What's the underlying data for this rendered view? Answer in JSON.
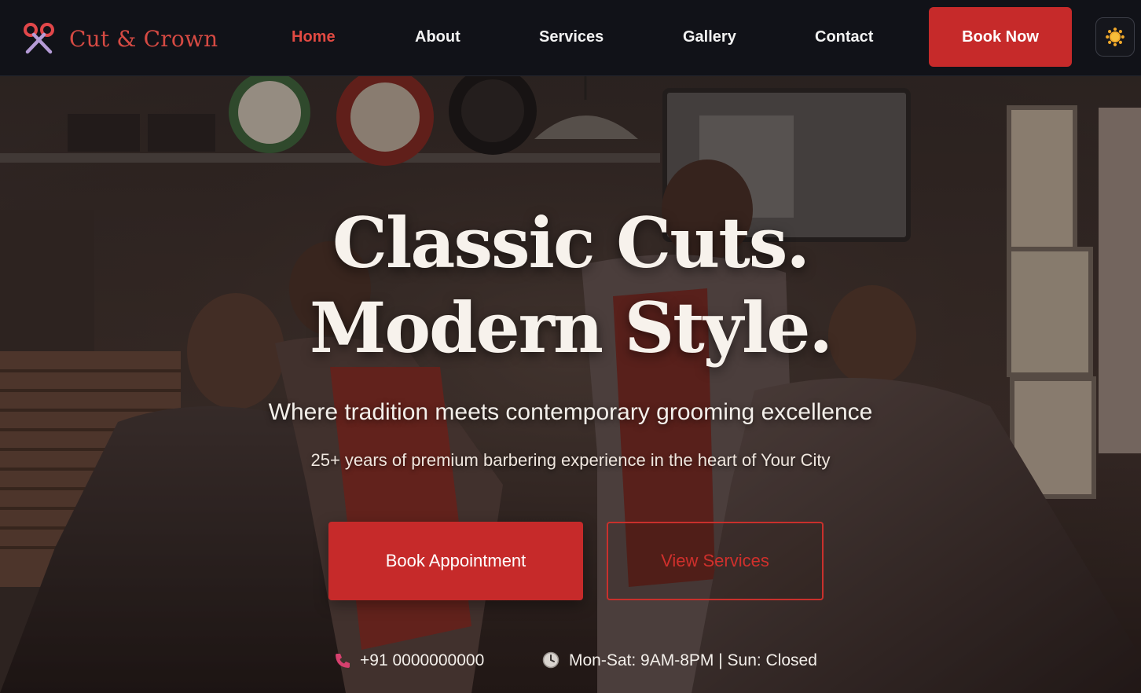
{
  "brand": {
    "name": "Cut & Crown",
    "icon": "scissors-icon",
    "color": "#d64a43"
  },
  "nav": {
    "items": [
      {
        "label": "Home",
        "active": true
      },
      {
        "label": "About",
        "active": false
      },
      {
        "label": "Services",
        "active": false
      },
      {
        "label": "Gallery",
        "active": false
      },
      {
        "label": "Contact",
        "active": false
      }
    ],
    "cta_label": "Book Now",
    "theme_toggle_icon": "sun-icon"
  },
  "hero": {
    "title_line1": "Classic Cuts.",
    "title_line2": "Modern Style.",
    "tagline": "Where tradition meets contemporary grooming excellence",
    "subtext": "25+ years of premium barbering experience in the heart of Your City",
    "primary_button": "Book Appointment",
    "secondary_button": "View Services",
    "phone": "+91 0000000000",
    "hours": "Mon-Sat: 9AM-8PM | Sun: Closed",
    "phone_icon": "phone-icon",
    "clock_icon": "clock-icon",
    "background": "barbershop-photo"
  },
  "colors": {
    "accent": "#c62a2a",
    "accent_text": "#e24a42",
    "header_bg": "#111218",
    "title_text": "#f7f2ec"
  }
}
